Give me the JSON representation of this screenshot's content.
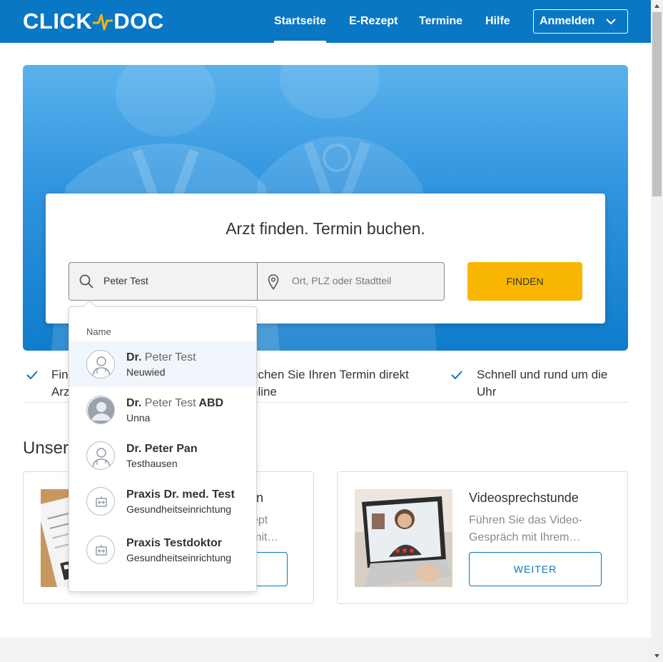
{
  "header": {
    "logo_left": "CLICK",
    "logo_right": "DOC",
    "nav": [
      {
        "label": "Startseite",
        "active": true
      },
      {
        "label": "E-Rezept",
        "active": false
      },
      {
        "label": "Termine",
        "active": false
      },
      {
        "label": "Hilfe",
        "active": false
      }
    ],
    "login_label": "Anmelden",
    "brand_color": "#0a77c4"
  },
  "search": {
    "title": "Arzt finden. Termin buchen.",
    "query_value": "Peter Test",
    "location_placeholder": "Ort, PLZ oder Stadtteil",
    "find_label": "FINDEN",
    "find_color": "#f9b600"
  },
  "features": [
    {
      "line1": "Fin",
      "line2": "Arz"
    },
    {
      "line1": "uchen Sie Ihren Termin direkt",
      "line2": "nline"
    },
    {
      "line1": "Schnell und rund um die",
      "line2": "Uhr"
    }
  ],
  "section_title": "Unser",
  "cards": [
    {
      "title": "n",
      "desc_line1": "ept",
      "desc_line2": "mit…",
      "button": ""
    },
    {
      "title": "Videosprechstunde",
      "desc_line1": "Führen Sie das Video-",
      "desc_line2": "Gespräch mit Ihrem…",
      "button": "WEITER"
    }
  ],
  "dropdown": {
    "heading": "Name",
    "items": [
      {
        "prefix": "Dr.",
        "match": "Peter Test",
        "suffix": "",
        "sub": "Neuwied",
        "icon": "doctor-avatar-icon",
        "highlighted": true
      },
      {
        "prefix": "Dr.",
        "match": "Peter Test",
        "suffix": "ABD",
        "sub": "Unna",
        "icon": "person-avatar-icon",
        "highlighted": false
      },
      {
        "prefix": "Dr. Peter Pan",
        "match": "",
        "suffix": "",
        "sub": "Testhausen",
        "icon": "doctor-avatar-icon",
        "highlighted": false
      },
      {
        "prefix": "Praxis Dr. med. Test",
        "match": "",
        "suffix": "",
        "sub": "Gesundheitseinrichtung",
        "icon": "building-icon",
        "highlighted": false
      },
      {
        "prefix": "Praxis Testdoktor",
        "match": "",
        "suffix": "",
        "sub": "Gesundheitseinrichtung",
        "icon": "building-icon",
        "highlighted": false
      }
    ]
  }
}
